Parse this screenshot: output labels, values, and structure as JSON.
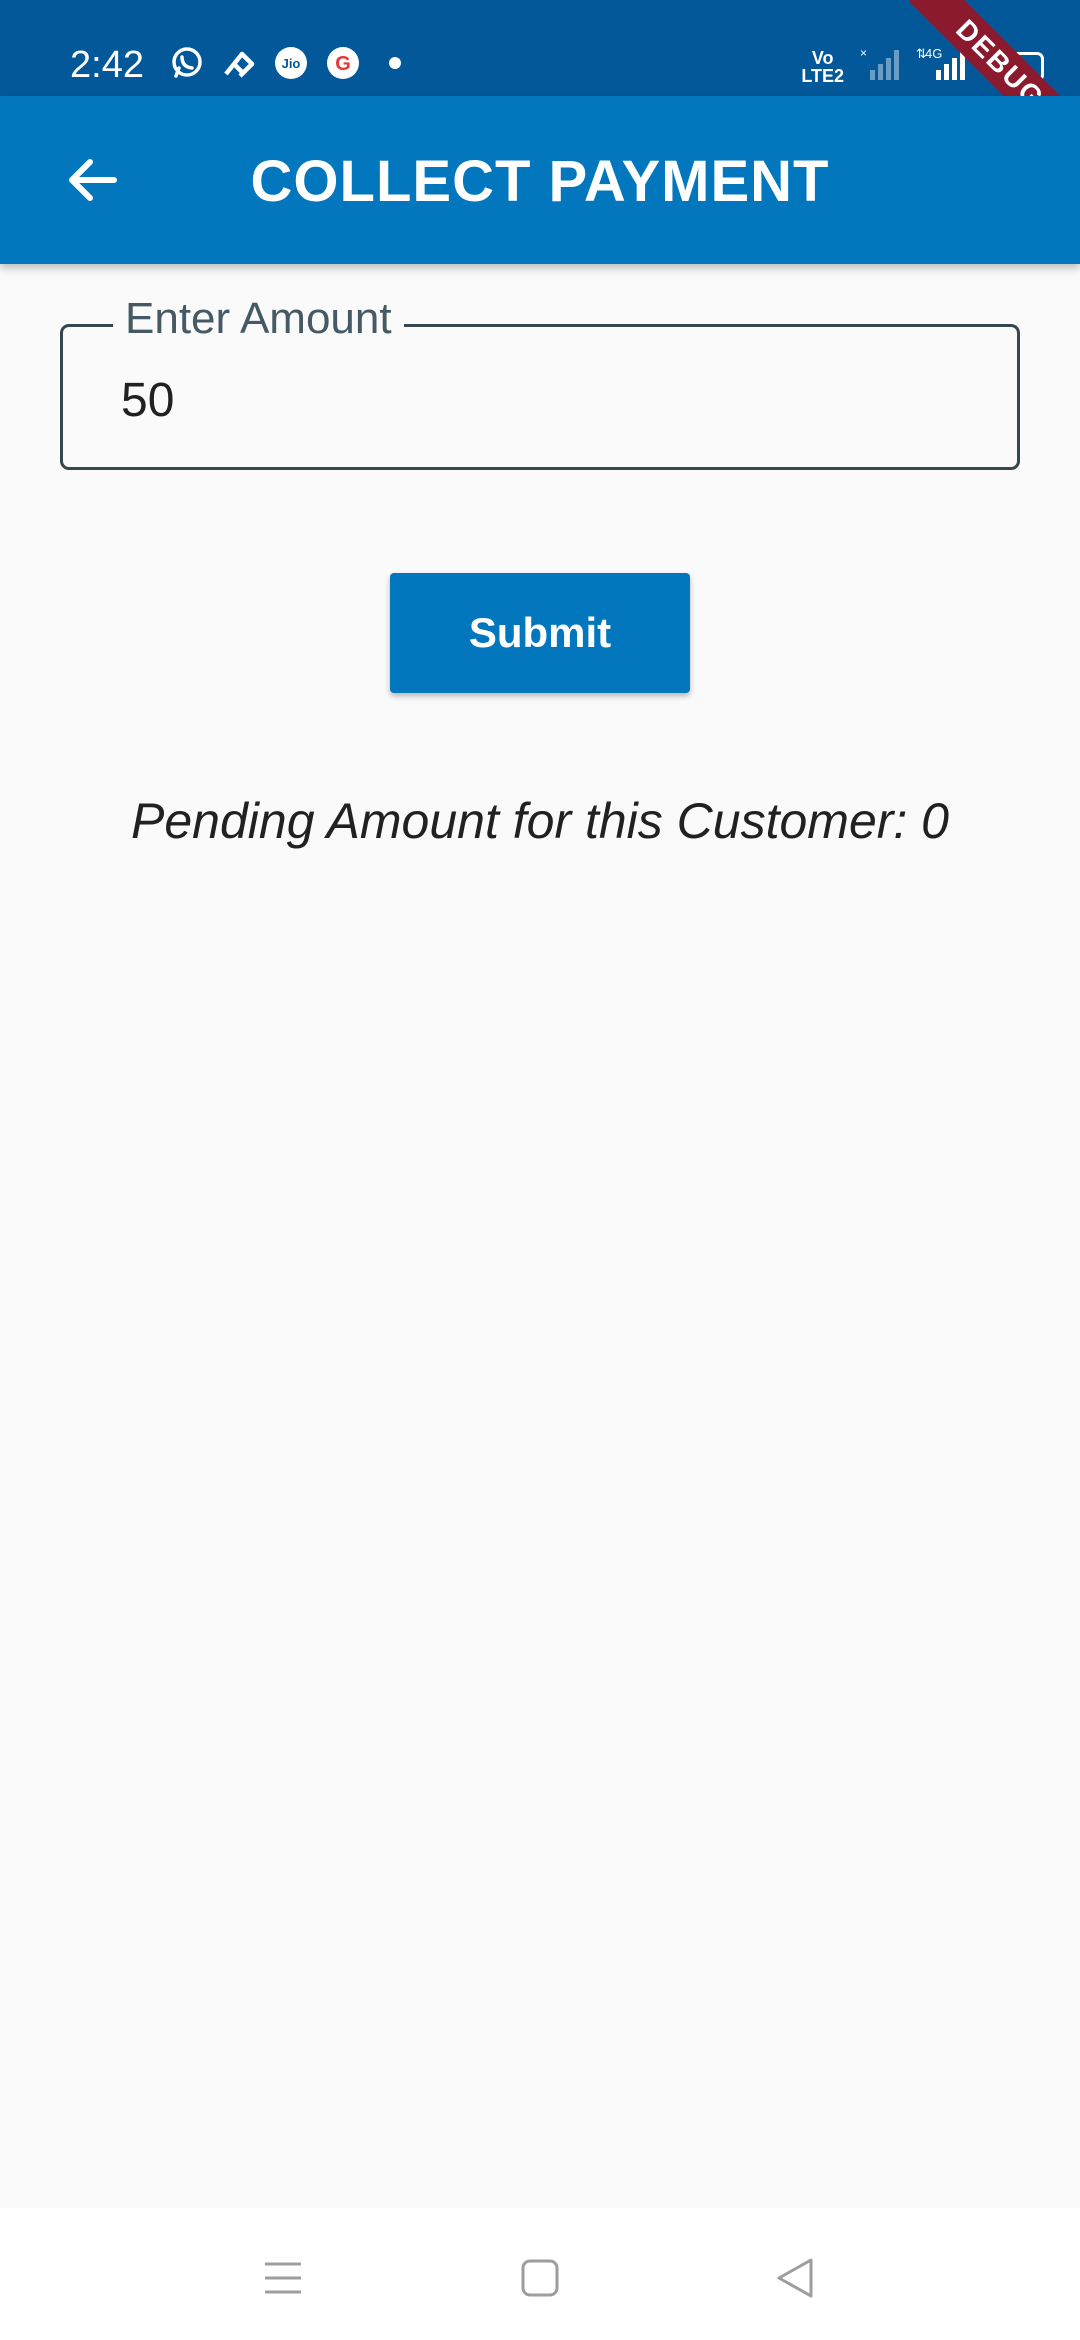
{
  "status_bar": {
    "time": "2:42",
    "left_icons": [
      "whatsapp-icon",
      "phonepe-icon",
      "jio-icon",
      "google-icon",
      "dot-icon"
    ],
    "volte_label_top": "Vo",
    "volte_label_bottom": "LTE2",
    "network_label": "4G",
    "battery_level": "33",
    "debug_banner": "DEBUG",
    "background_color": "#03589a"
  },
  "app_bar": {
    "title": "COLLECT PAYMENT",
    "back_icon": "arrow-back-icon",
    "background_color": "#0277bd"
  },
  "amount_field": {
    "label": "Enter Amount",
    "value": "50"
  },
  "submit_button": {
    "label": "Submit"
  },
  "pending_text": "Pending Amount for this Customer: 0",
  "nav_bar": {
    "icons": [
      "menu-icon",
      "home-icon",
      "back-icon"
    ]
  }
}
